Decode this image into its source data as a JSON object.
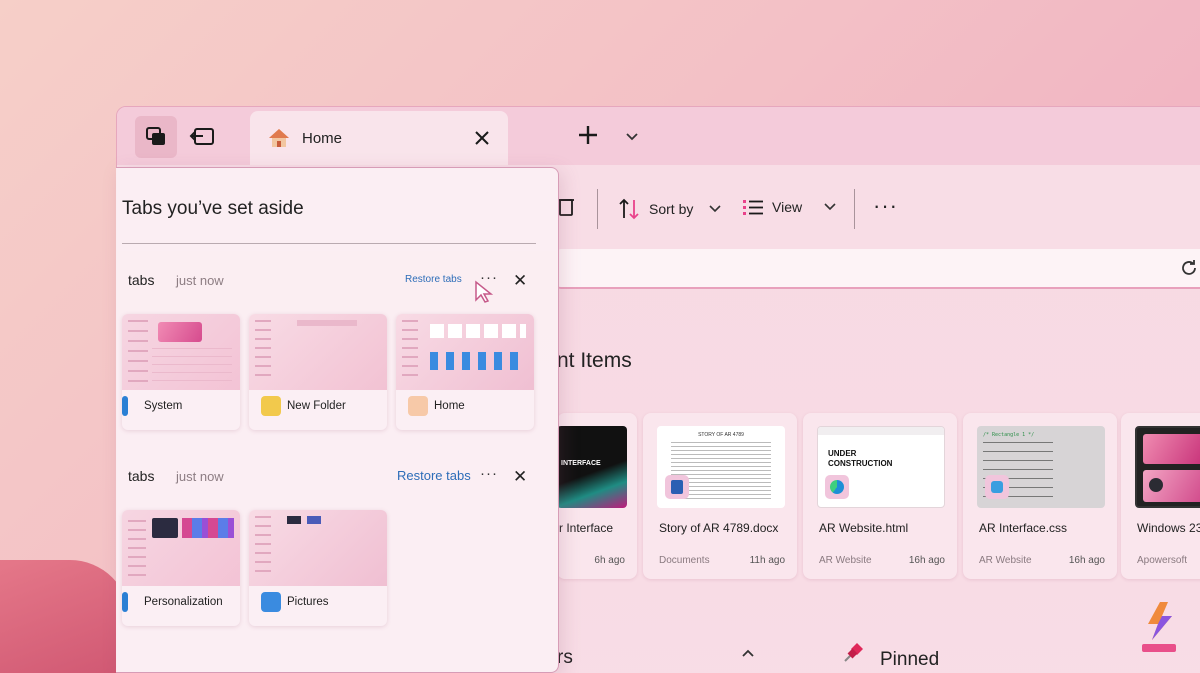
{
  "colors": {
    "accent": "#2d6db8",
    "brand_pink": "#e9428b",
    "bg": "#f3c0c6"
  },
  "tabbar": {
    "home_tab_label": "Home",
    "icons": [
      "tab-sets-icon",
      "set-aside-icon",
      "home-icon",
      "close-icon",
      "plus-icon",
      "chevron-down-icon"
    ]
  },
  "toolbar": {
    "sort_label": "Sort by",
    "view_label": "View",
    "more": "···"
  },
  "main": {
    "section_title_partial": "nt Items",
    "recent_cards": [
      {
        "name": "r Interface",
        "location": "",
        "time": "6h ago",
        "thumb_text": "INTERFACE"
      },
      {
        "name": "Story of AR 4789.docx",
        "location": "Documents",
        "time": "11h ago",
        "thumb_text": "STORY OF AR 4789"
      },
      {
        "name": "AR Website.html",
        "location": "AR Website",
        "time": "16h ago",
        "thumb_text": "UNDER CONSTRUCTION"
      },
      {
        "name": "AR Interface.css",
        "location": "AR Website",
        "time": "16h ago",
        "thumb_text": "/* Rectangle 1 */"
      },
      {
        "name": "Windows 23.",
        "location": "Apowersoft",
        "time": "",
        "thumb_text": ""
      }
    ],
    "bottom_partial": "rs",
    "pinned_label": "Pinned"
  },
  "panel": {
    "title": "Tabs you’ve set aside",
    "groups": [
      {
        "label": "tabs",
        "time": "just now",
        "restore_label": "Restore tabs",
        "dots": "···",
        "close": "✕",
        "tiles": [
          {
            "name": "System"
          },
          {
            "name": "New Folder"
          },
          {
            "name": "Home"
          }
        ]
      },
      {
        "label": "tabs",
        "time": "just now",
        "restore_label": "Restore tabs",
        "dots": "···",
        "close": "✕",
        "tiles": [
          {
            "name": "Personalization"
          },
          {
            "name": "Pictures"
          }
        ]
      }
    ]
  }
}
